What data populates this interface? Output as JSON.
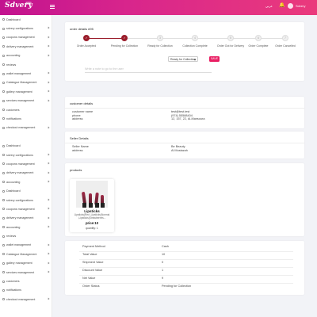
{
  "header": {
    "logo": "Sdvery",
    "logo_badge": "beta",
    "language": "عربي",
    "user": "Sdvery"
  },
  "sidebar": {
    "items": [
      {
        "label": "Dashboard",
        "chevron": false
      },
      {
        "label": "sdvery configurations",
        "chevron": true
      },
      {
        "label": "coupons management",
        "chevron": true
      },
      {
        "label": "delivery management",
        "chevron": true
      },
      {
        "label": "accounting",
        "chevron": true
      },
      {
        "label": "reviews",
        "chevron": false
      },
      {
        "label": "wallet management",
        "chevron": true
      },
      {
        "label": "Catalogue Management",
        "chevron": true
      },
      {
        "label": "gallery management",
        "chevron": true
      },
      {
        "label": "services management",
        "chevron": true
      },
      {
        "label": "customers",
        "chevron": false
      },
      {
        "label": "notifications",
        "chevron": false
      },
      {
        "label": "checkout management",
        "chevron": true
      },
      {
        "label": "",
        "chevron": false
      },
      {
        "label": "Dashboard",
        "chevron": false
      },
      {
        "label": "sdvery configurations",
        "chevron": true
      },
      {
        "label": "coupons management",
        "chevron": true
      },
      {
        "label": "delivery management",
        "chevron": true
      },
      {
        "label": "accounting",
        "chevron": true
      },
      {
        "label": "Dashboard",
        "chevron": false
      },
      {
        "label": "sdvery configurations",
        "chevron": true
      },
      {
        "label": "coupons management",
        "chevron": true
      },
      {
        "label": "delivery management",
        "chevron": true
      },
      {
        "label": "accounting",
        "chevron": true
      },
      {
        "label": "reviews",
        "chevron": false
      },
      {
        "label": "wallet management",
        "chevron": true
      },
      {
        "label": "Catalogue Management",
        "chevron": true
      },
      {
        "label": "gallery management",
        "chevron": true
      },
      {
        "label": "services management",
        "chevron": true
      },
      {
        "label": "customers",
        "chevron": false
      },
      {
        "label": "notifications",
        "chevron": false
      },
      {
        "label": "checkout management",
        "chevron": true
      }
    ]
  },
  "order": {
    "title": "order details #95",
    "steps": [
      {
        "label": "Order Accepted",
        "done": true
      },
      {
        "label": "Pending for Collection",
        "done": true
      },
      {
        "label": "Ready for Collection",
        "done": false,
        "num": "3"
      },
      {
        "label": "Collection Complete",
        "done": false,
        "num": "4"
      },
      {
        "label": "Order Out for Delivery",
        "done": false,
        "num": "5"
      },
      {
        "label": "Order Complete",
        "done": false,
        "num": "6"
      },
      {
        "label": "Order Cancelled",
        "done": false,
        "num": "7"
      }
    ],
    "status_select": "Ready for Collection",
    "save_label": "SAVE",
    "note_placeholder": "Write a note to go to the user"
  },
  "customer": {
    "title": "customer details",
    "labels": [
      "customer name",
      "phone",
      "address"
    ],
    "values": [
      "test@test.test",
      "(974) 55588404",
      "12, 157, 22, Al-Mansoura"
    ]
  },
  "seller": {
    "title": "Seller Details",
    "labels": [
      "Seller Name",
      "address"
    ],
    "values": [
      "Be Beauty",
      "Al Mostazah"
    ]
  },
  "products": {
    "title": "products",
    "items": [
      {
        "name": "Lipsticks",
        "description": "Lipsticks(Red ,Lipsticks(Normal ,Lipsticks(Strawberries...",
        "price": "price:10",
        "quantity": "quantity: 1"
      }
    ]
  },
  "summary": {
    "rows": [
      {
        "label": "Payment Method",
        "value": "Cash"
      },
      {
        "label": "Total Value",
        "value": "10"
      },
      {
        "label": "Shipment Value",
        "value": "0"
      },
      {
        "label": "Discount Value",
        "value": "1"
      },
      {
        "label": "Net Value",
        "value": "9"
      },
      {
        "label": "Order Status",
        "value": "Pending for Collection"
      }
    ]
  },
  "colors": {
    "brand_gradient_start": "#c2138f",
    "brand_gradient_end": "#ea3a7c",
    "step_done": "#9a1d2b",
    "save_button": "#e91e63"
  }
}
